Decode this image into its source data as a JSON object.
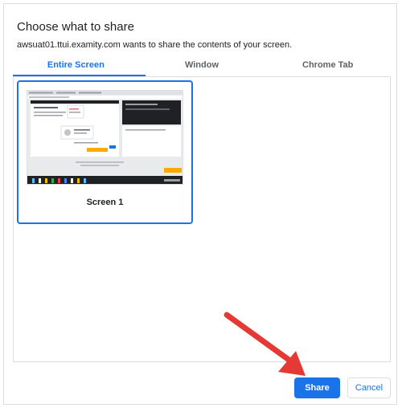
{
  "dialog": {
    "title": "Choose what to share",
    "subtitle": "awsuat01.ttui.examity.com wants to share the contents of your screen."
  },
  "tabs": [
    {
      "label": "Entire Screen",
      "active": true
    },
    {
      "label": "Window",
      "active": false
    },
    {
      "label": "Chrome Tab",
      "active": false
    }
  ],
  "sources": [
    {
      "label": "Screen 1",
      "selected": true
    }
  ],
  "buttons": {
    "share": "Share",
    "cancel": "Cancel"
  },
  "colors": {
    "accent": "#1a73e8",
    "annotation_arrow": "#e53935"
  }
}
